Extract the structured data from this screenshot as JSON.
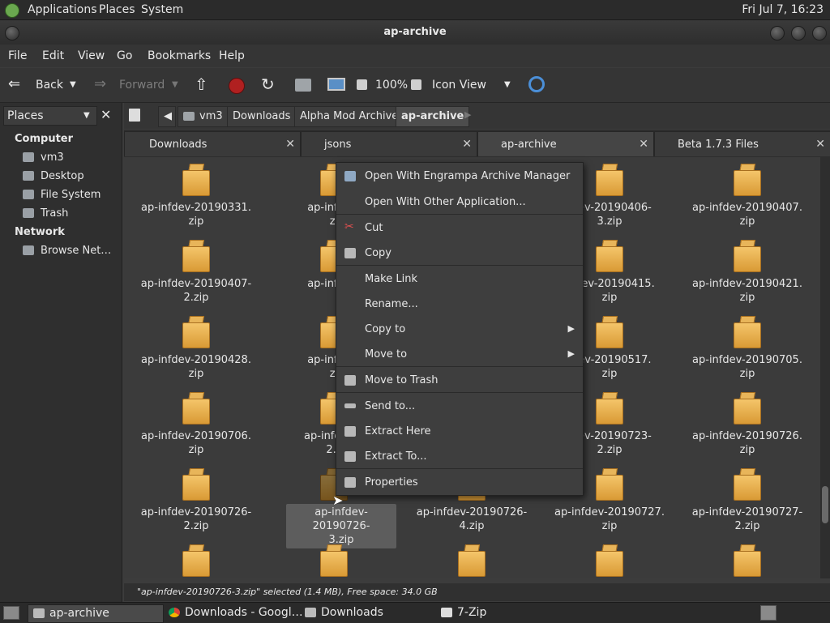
{
  "top_panel": {
    "menus": [
      "Applications",
      "Places",
      "System"
    ],
    "clock": "Fri Jul  7, 16:23"
  },
  "window": {
    "title": "ap-archive"
  },
  "menubar": [
    "File",
    "Edit",
    "View",
    "Go",
    "Bookmarks",
    "Help"
  ],
  "toolbar": {
    "back": "Back",
    "forward": "Forward",
    "zoom": "100%",
    "view_mode": "Icon View"
  },
  "sidebar": {
    "selector": "Places",
    "sections": [
      {
        "title": "Computer",
        "items": [
          "vm3",
          "Desktop",
          "File System",
          "Trash"
        ]
      },
      {
        "title": "Network",
        "items": [
          "Browse Net…"
        ]
      }
    ]
  },
  "breadcrumb": [
    "vm3",
    "Downloads",
    "Alpha Mod Archive",
    "ap-archive"
  ],
  "tabs": [
    {
      "label": "Downloads"
    },
    {
      "label": "jsons"
    },
    {
      "label": "ap-archive"
    },
    {
      "label": "Beta 1.7.3 Files"
    }
  ],
  "files": [
    {
      "line1": "ap-infdev-20190331.",
      "line2": "zip"
    },
    {
      "line1": "ap-infdev-",
      "line2": "zi"
    },
    {
      "line1": "",
      "line2": ""
    },
    {
      "line1": "fdev-20190406-",
      "line2": "3.zip"
    },
    {
      "line1": "ap-infdev-20190407.",
      "line2": "zip"
    },
    {
      "line1": "ap-infdev-20190407-",
      "line2": "2.zip"
    },
    {
      "line1": "ap-infdev-",
      "line2": ""
    },
    {
      "line1": "",
      "line2": ""
    },
    {
      "line1": "nfdev-20190415.",
      "line2": "zip"
    },
    {
      "line1": "ap-infdev-20190421.",
      "line2": "zip"
    },
    {
      "line1": "ap-infdev-20190428.",
      "line2": "zip"
    },
    {
      "line1": "ap-infdev-",
      "line2": "zi"
    },
    {
      "line1": "",
      "line2": ""
    },
    {
      "line1": "fdev-20190517.",
      "line2": "zip"
    },
    {
      "line1": "ap-infdev-20190705.",
      "line2": "zip"
    },
    {
      "line1": "ap-infdev-20190706.",
      "line2": "zip"
    },
    {
      "line1": "ap-infdev-2",
      "line2": "2.z"
    },
    {
      "line1": "",
      "line2": ""
    },
    {
      "line1": "fdev-20190723-",
      "line2": "2.zip"
    },
    {
      "line1": "ap-infdev-20190726.",
      "line2": "zip"
    },
    {
      "line1": "ap-infdev-20190726-",
      "line2": "2.zip"
    },
    {
      "line1": "ap-infdev-20190726-",
      "line2": "3.zip"
    },
    {
      "line1": "ap-infdev-20190726-",
      "line2": "4.zip"
    },
    {
      "line1": "ap-infdev-20190727.",
      "line2": "zip"
    },
    {
      "line1": "ap-infdev-20190727-",
      "line2": "2.zip"
    }
  ],
  "context_menu": [
    "Open With Engrampa Archive Manager",
    "Open With Other Application...",
    "Cut",
    "Copy",
    "Make Link",
    "Rename...",
    "Copy to",
    "Move to",
    "Move to Trash",
    "Send to...",
    "Extract Here",
    "Extract To...",
    "Properties"
  ],
  "status": "\"ap-infdev-20190726-3.zip\" selected (1.4 MB), Free space: 34.0 GB",
  "taskbar": [
    "ap-archive",
    "Downloads - Googl…",
    "Downloads",
    "7-Zip"
  ]
}
